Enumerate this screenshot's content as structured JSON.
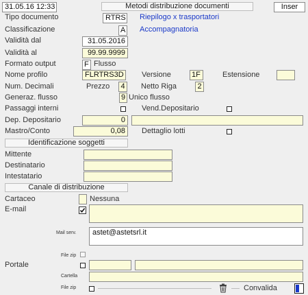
{
  "header": {
    "datetime": "31.05.16 12:33",
    "title": "Metodi distribuzione documenti",
    "mode": "Inser"
  },
  "fields": {
    "tipo_documento": {
      "label": "Tipo documento",
      "value": "RTRS",
      "desc": "Riepilogo x trasportatori"
    },
    "classificazione": {
      "label": "Classificazione",
      "value": "A",
      "desc": "Accompagnatoria"
    },
    "validita_dal": {
      "label": "Validità dal",
      "value": "31.05.2016"
    },
    "validita_al": {
      "label": "Validità  al",
      "value": "99.99.9999"
    },
    "formato_output": {
      "label": "Formato output",
      "value": "F",
      "desc": "Flusso"
    },
    "nome_profilo": {
      "label": "Nome profilo",
      "value": "FLRTRS3D"
    },
    "versione": {
      "label": "Versione",
      "value": "1F"
    },
    "estensione": {
      "label": "Estensione",
      "value": ""
    },
    "num_decimali": {
      "label": "Num. Decimali"
    },
    "prezzo": {
      "label": "Prezzo",
      "value": "4"
    },
    "netto_riga": {
      "label": "Netto Riga",
      "value": "2"
    },
    "generaz_flusso": {
      "label": "Generaz. flusso",
      "value": "9",
      "desc": "Unico flusso"
    },
    "passaggi_interni": {
      "label": "Passaggi interni"
    },
    "vend_depositario": {
      "label": "Vend.Depositario"
    },
    "dep_depositario": {
      "label": "Dep. Depositario",
      "value": "0",
      "desc": ""
    },
    "mastro_conto": {
      "label": "Mastro/Conto",
      "value": "0,08"
    },
    "dettaglio_lotti": {
      "label": "Dettaglio lotti"
    }
  },
  "sections": {
    "identificazione": "Identificazione soggetti",
    "canale": "Canale di distribuzione"
  },
  "soggetti": {
    "mittente": {
      "label": "Mittente",
      "value": ""
    },
    "destinatario": {
      "label": "Destinatario",
      "value": ""
    },
    "intestatario": {
      "label": "Intestatario",
      "value": ""
    }
  },
  "canale": {
    "cartaceo": {
      "label": "Cartaceo",
      "value": "",
      "desc": "Nessuna"
    },
    "email": {
      "label": "E-mail",
      "checked": true,
      "value": ""
    },
    "mail_serv": {
      "label": "Mail serv.",
      "value": "astet@astetsrl.it"
    },
    "file_zip_1": {
      "label": "File zip"
    },
    "portale": {
      "label": "Portale",
      "value1": "",
      "value2": ""
    },
    "cartella": {
      "label": "Cartella",
      "value": ""
    },
    "file_zip_2": {
      "label": "File zip"
    },
    "convalida": {
      "label": "Convalida"
    }
  },
  "colors": {
    "field_bg": "#fbfbd9",
    "link_blue": "#1a39c8"
  }
}
